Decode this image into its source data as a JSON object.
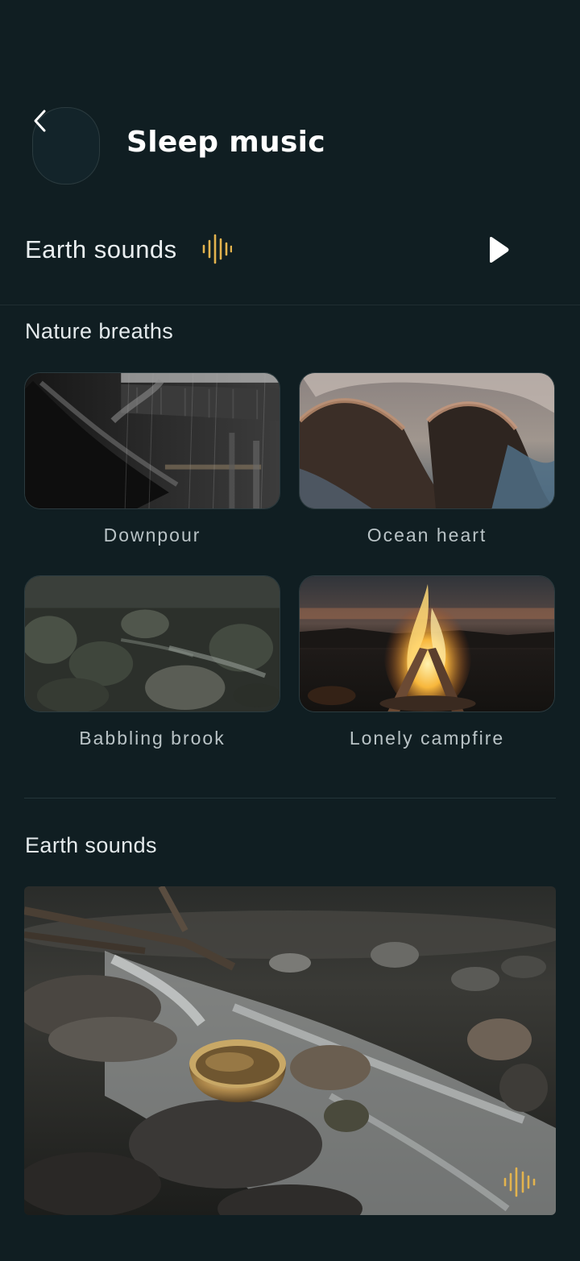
{
  "header": {
    "title": "Sleep music",
    "back_icon": "chevron-left-icon"
  },
  "now_playing": {
    "label": "Earth sounds",
    "wave_icon": "audio-wave-icon",
    "play_icon": "play-icon",
    "accent_color": "#e3b34e"
  },
  "nature_breaths": {
    "title": "Nature breaths",
    "items": [
      {
        "label": "Downpour",
        "image": "rain-on-roof-image"
      },
      {
        "label": "Ocean heart",
        "image": "ocean-waves-image"
      },
      {
        "label": "Babbling brook",
        "image": "rocky-brook-image"
      },
      {
        "label": "Lonely campfire",
        "image": "campfire-image"
      }
    ]
  },
  "earth_sounds": {
    "title": "Earth sounds",
    "image": "singing-bowl-river-image",
    "wave_icon": "audio-wave-icon"
  },
  "colors": {
    "background": "#101e22",
    "text": "#e8eef0",
    "accent": "#e3b34e"
  }
}
